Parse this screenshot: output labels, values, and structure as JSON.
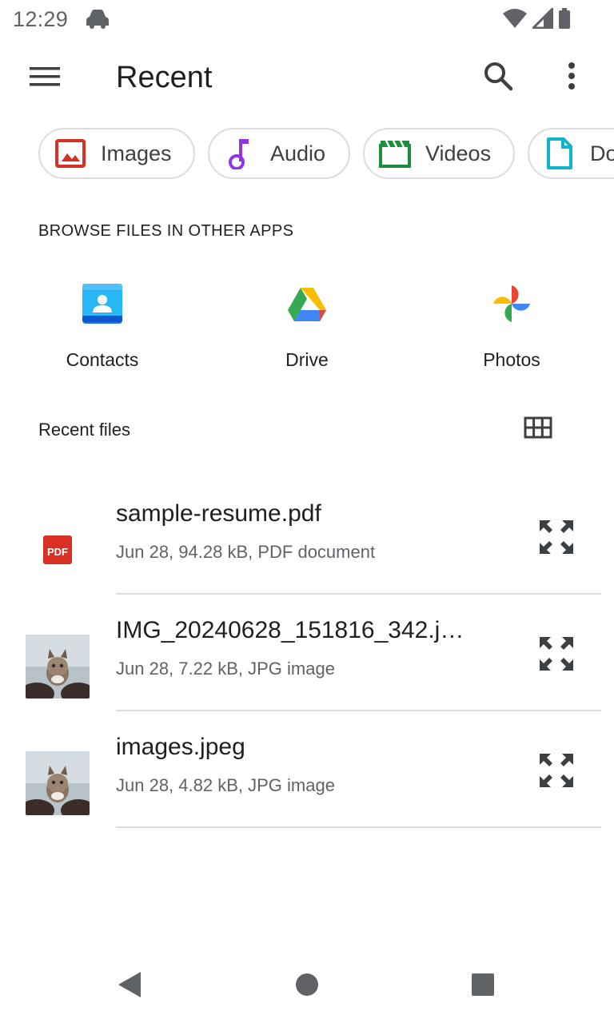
{
  "status_bar": {
    "time": "12:29",
    "icons": [
      "car-icon",
      "wifi-icon",
      "signal-icon",
      "battery-icon"
    ]
  },
  "app_bar": {
    "title": "Recent",
    "icons": [
      "menu-icon",
      "search-icon",
      "more-vert-icon"
    ]
  },
  "chips": [
    {
      "label": "Images",
      "icon": "image-icon",
      "color": "#d93025"
    },
    {
      "label": "Audio",
      "icon": "music-note-icon",
      "color": "#9334e6"
    },
    {
      "label": "Videos",
      "icon": "movie-icon",
      "color": "#1e8e3e"
    },
    {
      "label": "Do",
      "icon": "document-icon",
      "color": "#12b5cb"
    }
  ],
  "browse": {
    "header": "BROWSE FILES IN OTHER APPS",
    "apps": [
      {
        "label": "Contacts",
        "icon": "contacts-app-icon"
      },
      {
        "label": "Drive",
        "icon": "drive-app-icon"
      },
      {
        "label": "Photos",
        "icon": "photos-app-icon"
      }
    ]
  },
  "recent": {
    "header": "Recent files",
    "view_toggle_icon": "grid-view-icon",
    "files": [
      {
        "name": "sample-resume.pdf",
        "meta": "Jun 28, 94.28 kB, PDF document",
        "thumb": "pdf-icon"
      },
      {
        "name": "IMG_20240628_151816_342.j…",
        "meta": "Jun 28, 7.22 kB, JPG image",
        "thumb": "cat-photo-thumbnail"
      },
      {
        "name": "images.jpeg",
        "meta": "Jun 28, 4.82 kB, JPG image",
        "thumb": "cat-photo-thumbnail"
      }
    ]
  },
  "nav_bar": {
    "icons": [
      "back-icon",
      "home-icon",
      "recents-icon"
    ]
  }
}
